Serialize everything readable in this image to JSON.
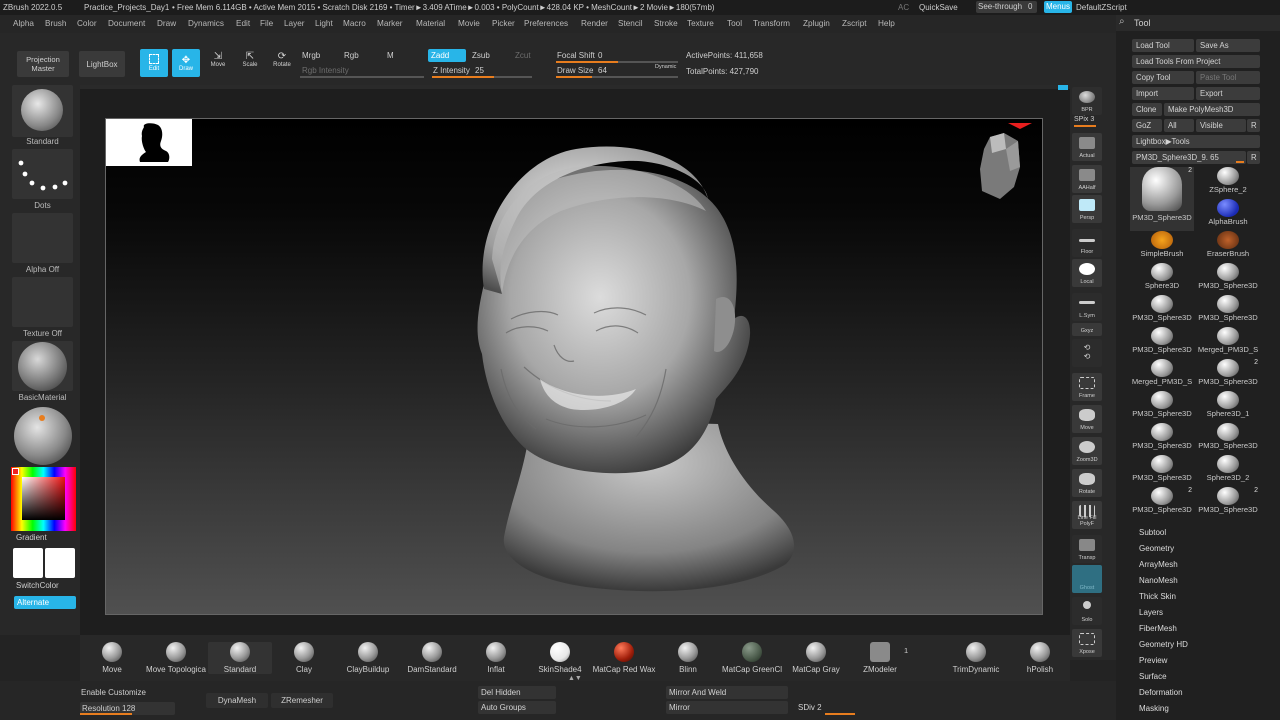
{
  "titlebar": {
    "app": "ZBrush 2022.0.5",
    "project": "Practice_Projects_Day1",
    "stats": "• Free Mem 6.114GB • Active Mem 2015 • Scratch Disk 2169 • Timer►3.409 ATime►0.003 • PolyCount►428.04 KP • MeshCount►2 Movie►180(57mb)",
    "ac": "AC",
    "quicksave": "QuickSave",
    "seethrough": "See-through",
    "seethrough_val": "0",
    "menus": "Menus",
    "script": "DefaultZScript"
  },
  "menus": [
    "Alpha",
    "Brush",
    "Color",
    "Document",
    "Draw",
    "Dynamics",
    "Edit",
    "File",
    "Layer",
    "Light",
    "Macro",
    "Marker",
    "Material",
    "Movie",
    "Picker",
    "Preferences",
    "Render",
    "Stencil",
    "Stroke",
    "Texture",
    "Tool",
    "Transform",
    "Zplugin",
    "Zscript",
    "Help"
  ],
  "toolbar": {
    "projection_master": "Projection Master",
    "lightbox": "LightBox",
    "edit": "Edit",
    "draw": "Draw",
    "move": "Move",
    "scale": "Scale",
    "rotate": "Rotate",
    "mrgb": "Mrgb",
    "rgb": "Rgb",
    "m": "M",
    "rgb_intensity": "Rgb Intensity",
    "zadd": "Zadd",
    "zsub": "Zsub",
    "zcut": "Zcut",
    "z_intensity_label": "Z Intensity",
    "z_intensity": "25",
    "focal_shift_label": "Focal Shift",
    "focal_shift": "0",
    "draw_size_label": "Draw Size",
    "draw_size": "64",
    "dynamic": "Dynamic",
    "active_points": "ActivePoints: 411,658",
    "total_points": "TotalPoints: 427,790"
  },
  "leftshelf": {
    "standard": "Standard",
    "dots": "Dots",
    "alpha_off": "Alpha Off",
    "texture_off": "Texture Off",
    "basic_material": "BasicMaterial",
    "gradient": "Gradient",
    "switch_color": "SwitchColor",
    "alternate": "Alternate"
  },
  "rightshelf": [
    "BPR",
    "SPix 3",
    "Actual",
    "AAHalf",
    "Persp",
    "Floor",
    "Local",
    "L.Sym",
    "Gxyz",
    "Frame",
    "Move",
    "Zoom3D",
    "Rotate",
    "Line Fill PolyF",
    "Transp",
    "Ghost",
    "Solo",
    "Xpose"
  ],
  "tray": {
    "title": "Tool",
    "load_tool": "Load Tool",
    "save_as": "Save As",
    "load_from_project": "Load Tools From Project",
    "copy_tool": "Copy Tool",
    "paste_tool": "Paste Tool",
    "import": "Import",
    "export": "Export",
    "clone": "Clone",
    "make_polymesh": "Make PolyMesh3D",
    "goz": "GoZ",
    "all": "All",
    "visible": "Visible",
    "r": "R",
    "lightbox_tools": "Lightbox▶Tools",
    "current_tool": "PM3D_Sphere3D_9. 65",
    "tools": [
      {
        "name": "PM3D_Sphere3D",
        "count": "2"
      },
      {
        "name": "ZSphere_2",
        "count": ""
      },
      {
        "name": "AlphaBrush",
        "count": ""
      },
      {
        "name": "SimpleBrush",
        "count": ""
      },
      {
        "name": "EraserBrush",
        "count": ""
      },
      {
        "name": "Sphere3D",
        "count": ""
      },
      {
        "name": "PM3D_Sphere3D",
        "count": ""
      },
      {
        "name": "PM3D_Sphere3D",
        "count": ""
      },
      {
        "name": "PM3D_Sphere3D",
        "count": ""
      },
      {
        "name": "PM3D_Sphere3D",
        "count": ""
      },
      {
        "name": "Merged_PM3D_S",
        "count": ""
      },
      {
        "name": "Merged_PM3D_S",
        "count": ""
      },
      {
        "name": "PM3D_Sphere3D",
        "count": "2"
      },
      {
        "name": "PM3D_Sphere3D",
        "count": ""
      },
      {
        "name": "Sphere3D_1",
        "count": ""
      },
      {
        "name": "PM3D_Sphere3D",
        "count": ""
      },
      {
        "name": "PM3D_Sphere3D",
        "count": ""
      },
      {
        "name": "PM3D_Sphere3D",
        "count": ""
      },
      {
        "name": "Sphere3D_2",
        "count": ""
      },
      {
        "name": "PM3D_Sphere3D",
        "count": "2"
      },
      {
        "name": "PM3D_Sphere3D",
        "count": "2"
      }
    ],
    "subpalettes": [
      "Subtool",
      "Geometry",
      "ArrayMesh",
      "NanoMesh",
      "Thick Skin",
      "Layers",
      "FiberMesh",
      "Geometry HD",
      "Preview",
      "Surface",
      "Deformation",
      "Masking"
    ]
  },
  "brushes": [
    "Move",
    "Move Topologica",
    "Standard",
    "Clay",
    "ClayBuildup",
    "DamStandard",
    "Inflat",
    "SkinShade4",
    "MatCap Red Wax",
    "Blinn",
    "MatCap GreenCl",
    "MatCap Gray",
    "ZModeler",
    "TrimDynamic",
    "hPolish"
  ],
  "zmodeler_count": "1",
  "bottom": {
    "enable_customize": "Enable Customize",
    "resolution_label": "Resolution",
    "resolution": "128",
    "dynamesh": "DynaMesh",
    "zremesher": "ZRemesher",
    "del_hidden": "Del Hidden",
    "auto_groups": "Auto Groups",
    "mirror_and_weld": "Mirror And Weld",
    "mirror": "Mirror",
    "sdiv": "SDiv 2"
  },
  "colors": {
    "accent": "#28b5e8",
    "slider": "#e87d1e",
    "bg": "#232323"
  }
}
